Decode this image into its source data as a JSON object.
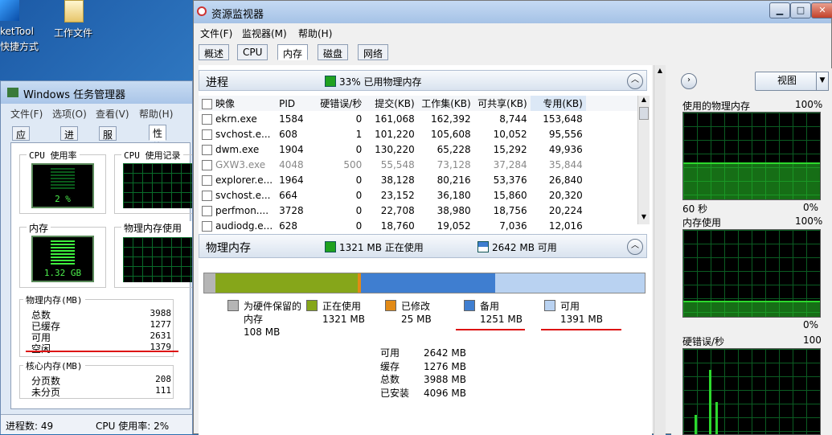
{
  "desktop": {
    "icon1_line1": "ketTool",
    "icon1_line2": "快捷方式",
    "icon2_label": "工作文件"
  },
  "task_manager": {
    "title": "Windows 任务管理器",
    "menu": [
      "文件(F)",
      "选项(O)",
      "查看(V)",
      "帮助(H)"
    ],
    "tabs": [
      "应用程序",
      "进程",
      "服务",
      "性能"
    ],
    "active_tab": "性能",
    "cpu_usage_label": "CPU 使用率",
    "cpu_history_label": "CPU 使用记录",
    "cpu_usage_value": "2 %",
    "mem_label": "内存",
    "mem_history_label": "物理内存使用记",
    "mem_value": "1.32 GB",
    "physical": {
      "title": "物理内存(MB)",
      "rows": [
        {
          "label": "总数",
          "value": "3988"
        },
        {
          "label": "已缓存",
          "value": "1277"
        },
        {
          "label": "可用",
          "value": "2631"
        },
        {
          "label": "空闲",
          "value": "1379"
        }
      ]
    },
    "kernel": {
      "title": "核心内存(MB)",
      "rows": [
        {
          "label": "分页数",
          "value": "208"
        },
        {
          "label": "未分页",
          "value": "111"
        }
      ]
    },
    "status": {
      "processes": "进程数: 49",
      "cpu": "CPU 使用率: 2%"
    }
  },
  "resmon": {
    "title": "资源监视器",
    "menu": [
      "文件(F)",
      "监视器(M)",
      "帮助(H)"
    ],
    "tabs": [
      "概述",
      "CPU",
      "内存",
      "磁盘",
      "网络"
    ],
    "active_tab": "内存",
    "process_section": {
      "name": "进程",
      "summary": "33% 已用物理内存",
      "columns": [
        "映像",
        "PID",
        "硬错误/秒",
        "提交(KB)",
        "工作集(KB)",
        "可共享(KB)",
        "专用(KB)"
      ],
      "rows": [
        [
          "ekrn.exe",
          "1584",
          "0",
          "161,068",
          "162,392",
          "8,744",
          "153,648"
        ],
        [
          "svchost.e...",
          "608",
          "1",
          "101,220",
          "105,608",
          "10,052",
          "95,556"
        ],
        [
          "dwm.exe",
          "1904",
          "0",
          "130,220",
          "65,228",
          "15,292",
          "49,936"
        ],
        [
          "GXW3.exe",
          "4048",
          "500",
          "55,548",
          "73,128",
          "37,284",
          "35,844"
        ],
        [
          "explorer.e...",
          "1964",
          "0",
          "38,128",
          "80,216",
          "53,376",
          "26,840"
        ],
        [
          "svchost.e...",
          "664",
          "0",
          "23,152",
          "36,180",
          "15,860",
          "20,320"
        ],
        [
          "perfmon....",
          "3728",
          "0",
          "22,708",
          "38,980",
          "18,756",
          "20,224"
        ],
        [
          "audiodg.e...",
          "628",
          "0",
          "18,760",
          "19,052",
          "7,036",
          "12,016"
        ]
      ]
    },
    "memory_section": {
      "name": "物理内存",
      "in_use_summary": "1321 MB 正在使用",
      "available_summary": "2642 MB 可用",
      "bar": {
        "reserved_mb": 108,
        "in_use_mb": 1321,
        "modified_mb": 25,
        "standby_mb": 1251,
        "free_mb": 1391
      },
      "legend": [
        {
          "label": "为硬件保留的内存",
          "value": "108 MB",
          "color": "#b5b5b5"
        },
        {
          "label": "正在使用",
          "value": "1321 MB",
          "color": "#86a61a"
        },
        {
          "label": "已修改",
          "value": "25 MB",
          "color": "#e28a16"
        },
        {
          "label": "备用",
          "value": "1251 MB",
          "color": "#3f7ed0"
        },
        {
          "label": "可用",
          "value": "1391 MB",
          "color": "#b9d2f1"
        }
      ],
      "totals": [
        {
          "label": "可用",
          "value": "2642 MB"
        },
        {
          "label": "缓存",
          "value": "1276 MB"
        },
        {
          "label": "总数",
          "value": "3988 MB"
        },
        {
          "label": "已安装",
          "value": "4096 MB"
        }
      ]
    },
    "right_panel": {
      "view_label": "视图",
      "graph1_title": "使用的物理内存",
      "graph1_max": "100%",
      "graph1_time": "60 秒",
      "graph1_min": "0%",
      "graph2_title": "内存使用",
      "graph2_max": "100%",
      "graph2_min": "0%",
      "graph3_title": "硬错误/秒",
      "graph3_max": "100"
    }
  }
}
